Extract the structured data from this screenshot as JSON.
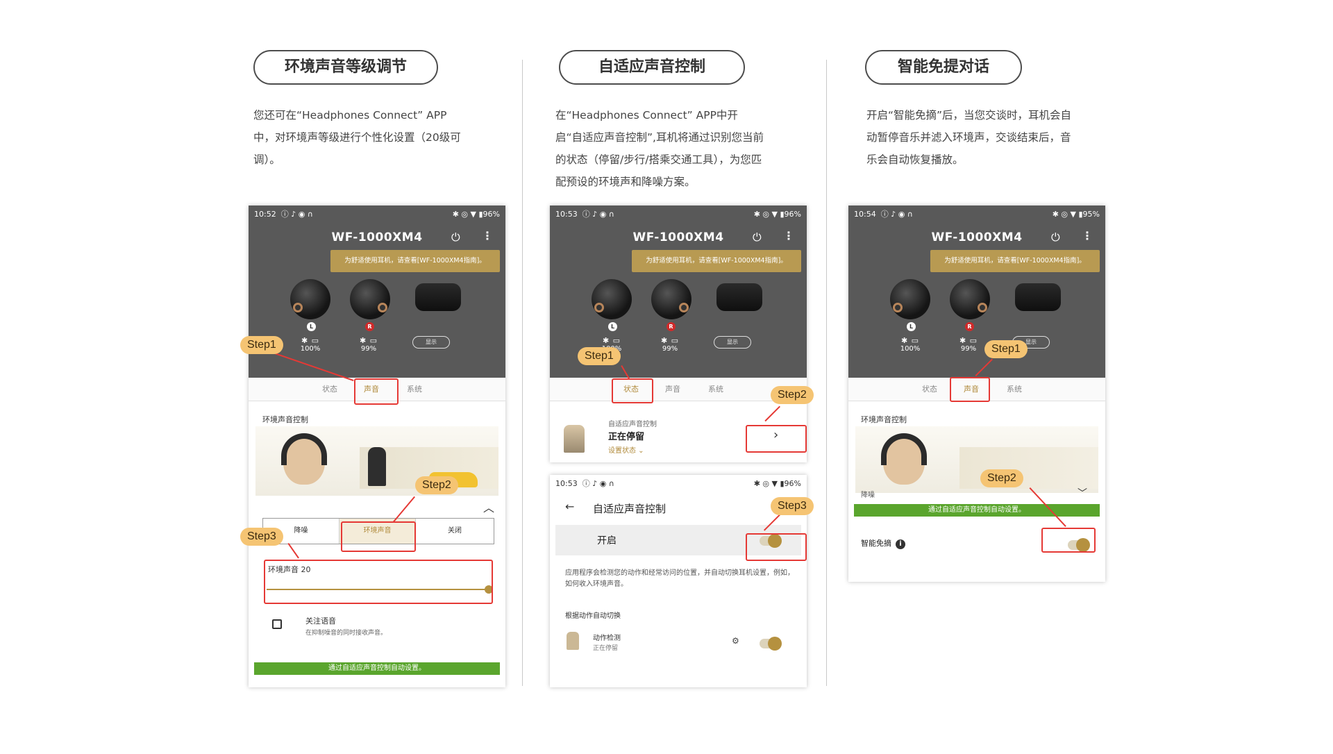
{
  "col1": {
    "title": "环境声音等级调节",
    "desc": "您还可在“Headphones Connect” APP中，对环境声等级进行个性化设置（20级可调）。",
    "phone": {
      "status_time": "10:52",
      "status_icons": "ⓘ ♪ ◉ ∩",
      "status_right": "✱ ◎ ▼ ▮96%",
      "model": "WF-1000XM4",
      "tip": "为舒适使用耳机，请查看[WF-1000XM4指南]。",
      "left_label": "L",
      "right_label": "R",
      "left_batt": "100%",
      "right_batt": "99%",
      "show_btn": "显示",
      "tabs": [
        "状态",
        "声音",
        "系统"
      ],
      "section_title": "环境声音控制",
      "segments": [
        "降噪",
        "环境声音",
        "关闭"
      ],
      "ambient_level": "环境声音 20",
      "ambient_level_value": 20,
      "focus_title": "关注语音",
      "focus_sub": "在抑制噪音的同时接收声音。",
      "green_bar": "通过自适应声音控制自动设置。"
    },
    "steps": [
      "Step1",
      "Step2",
      "Step3"
    ]
  },
  "col2": {
    "title": "自适应声音控制",
    "desc": "在“Headphones Connect” APP中开启“自适应声音控制”,耳机将通过识别您当前的状态（停留/步行/搭乘交通工具），为您匹配预设的环境声和降噪方案。",
    "phone": {
      "status_time": "10:53",
      "status_icons": "ⓘ ♪ ◉ ∩",
      "status_right": "✱ ◎ ▼ ▮96%",
      "model": "WF-1000XM4",
      "tip": "为舒适使用耳机，请查看[WF-1000XM4指南]。",
      "left_label": "L",
      "right_label": "R",
      "left_batt": "100%",
      "right_batt": "99%",
      "show_btn": "显示",
      "tabs": [
        "状态",
        "声音",
        "系统"
      ],
      "asc_label": "自适应声音控制",
      "asc_state": "正在停留",
      "asc_setting": "设置状态 ⌄"
    },
    "phone2": {
      "status_time": "10:53",
      "status_icons": "ⓘ ♪ ◉ ∩",
      "status_right": "✱ ◎ ▼ ▮96%",
      "back": "←",
      "title": "自适应声音控制",
      "toggle_label": "开启",
      "desc": "应用程序会检测您的动作和经常访问的位置，并自动切换耳机设置，例如，如何收入环境声音。",
      "auto_label": "根据动作自动切换",
      "detect_title": "动作检测",
      "detect_sub": "正在停留"
    },
    "steps": [
      "Step1",
      "Step2",
      "Step3"
    ]
  },
  "col3": {
    "title": "智能免提对话",
    "desc": "开启“智能免摘”后，当您交谈时，耳机会自动暂停音乐并滤入环境声，交谈结束后，音乐会自动恢复播放。",
    "phone": {
      "status_time": "10:54",
      "status_icons": "ⓘ ♪ ◉ ∩",
      "status_right": "✱ ◎ ▼ ▮95%",
      "model": "WF-1000XM4",
      "tip": "为舒适使用耳机，请查看[WF-1000XM4指南]。",
      "left_label": "L",
      "right_label": "R",
      "left_batt": "100%",
      "right_batt": "99%",
      "show_btn": "显示",
      "tabs": [
        "状态",
        "声音",
        "系统"
      ],
      "section_title": "环境声音控制",
      "mode": "降噪",
      "green_bar": "通过自适应声音控制自动设置。",
      "speak_label": "智能免摘",
      "info_icon": "i"
    },
    "steps": [
      "Step1",
      "Step2"
    ]
  },
  "colors": {
    "accent": "#b5913f",
    "highlight": "#e53935",
    "step_bg": "#f5c473",
    "green": "#5aa52d",
    "panel_dark": "#595959"
  }
}
